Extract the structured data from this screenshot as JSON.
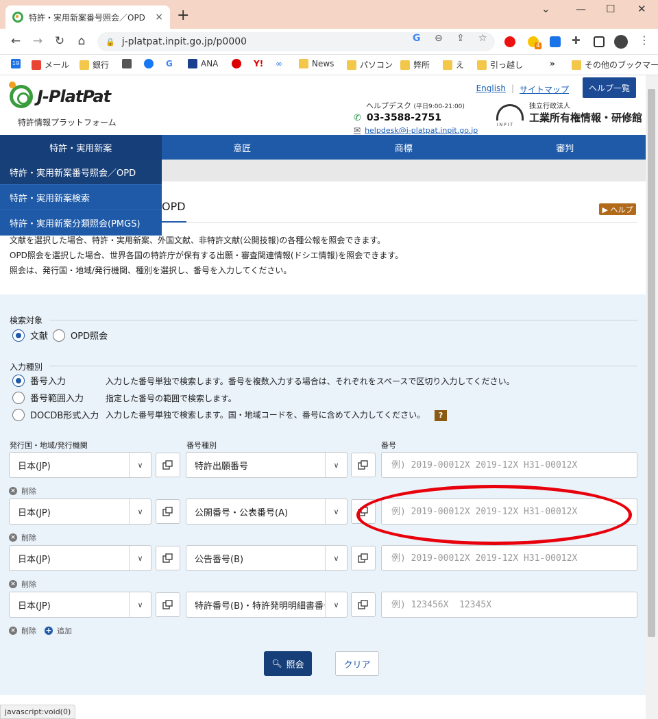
{
  "browser": {
    "tab_title": "特許・実用新案番号照会／OPD",
    "tab_close": "×",
    "new_tab": "+",
    "window_controls": {
      "minimize": "—",
      "maximize": "☐",
      "close": "✕"
    },
    "url": "j-platpat.inpit.go.jp/p0000",
    "extension_badge": "4",
    "bookmarks": [
      "メール",
      "銀行",
      "ANA",
      "News",
      "パソコン",
      "弊所",
      "え",
      "引っ越し"
    ],
    "bookmarks_more": "»",
    "bookmarks_other": "その他のブックマーク",
    "status_text": "javascript:void(0)"
  },
  "header": {
    "logo_text": "J-PlatPat",
    "logo_sub": "特許情報プラットフォーム",
    "english_link": "English",
    "sitemap_link": "サイトマップ",
    "help_list_button": "ヘルプ一覧",
    "helpdesk_title": "ヘルプデスク",
    "helpdesk_hours": "(平日9:00-21:00)",
    "helpdesk_phone": "03-3588-2751",
    "helpdesk_email": "helpdesk@j-platpat.inpit.go.jp",
    "inpit_small": "独立行政法人",
    "inpit_name": "工業所有権情報・研修館"
  },
  "nav": {
    "items": [
      "特許・実用新案",
      "意匠",
      "商標",
      "審判"
    ],
    "dropdown": [
      "特許・実用新案番号照会／OPD",
      "特許・実用新案検索",
      "特許・実用新案分類照会(PMGS)"
    ]
  },
  "page": {
    "title": "OPD",
    "help_button": "▶ ヘルプ",
    "description": [
      "文献を選択した場合、特許・実用新案、外国文献、非特許文献(公開技報)の各種公報を照会できます。",
      "OPD照会を選択した場合、世界各国の特許庁が保有する出願・審査関連情報(ドシエ情報)を照会できます。",
      "照会は、発行国・地域/発行機関、種別を選択し、番号を入力してください。"
    ]
  },
  "search": {
    "target_label": "検索対象",
    "target_options": [
      "文献",
      "OPD照会"
    ],
    "input_type_label": "入力種別",
    "input_types": [
      {
        "label": "番号入力",
        "desc": "入力した番号単独で検索します。番号を複数入力する場合は、それぞれをスペースで区切り入力してください。"
      },
      {
        "label": "番号範囲入力",
        "desc": "指定した番号の範囲で検索します。"
      },
      {
        "label": "DOCDB形式入力",
        "desc": "入力した番号単独で検索します。国・地域コードを、番号に含めて入力してください。"
      }
    ],
    "help_q": "?",
    "col_country": "発行国・地域/発行機関",
    "col_type": "番号種別",
    "col_number": "番号",
    "rows": [
      {
        "country": "日本(JP)",
        "type": "特許出願番号",
        "placeholder": "例) 2019-00012X 2019-12X H31-00012X"
      },
      {
        "country": "日本(JP)",
        "type": "公開番号・公表番号(A)",
        "placeholder": "例) 2019-00012X 2019-12X H31-00012X"
      },
      {
        "country": "日本(JP)",
        "type": "公告番号(B)",
        "placeholder": "例) 2019-00012X 2019-12X H31-00012X"
      },
      {
        "country": "日本(JP)",
        "type": "特許番号(B)・特許発明明細書番号(C)",
        "placeholder": "例) 123456X  12345X"
      }
    ],
    "delete_label": "削除",
    "add_label": "追加",
    "search_button": "照会",
    "clear_button": "クリア"
  }
}
